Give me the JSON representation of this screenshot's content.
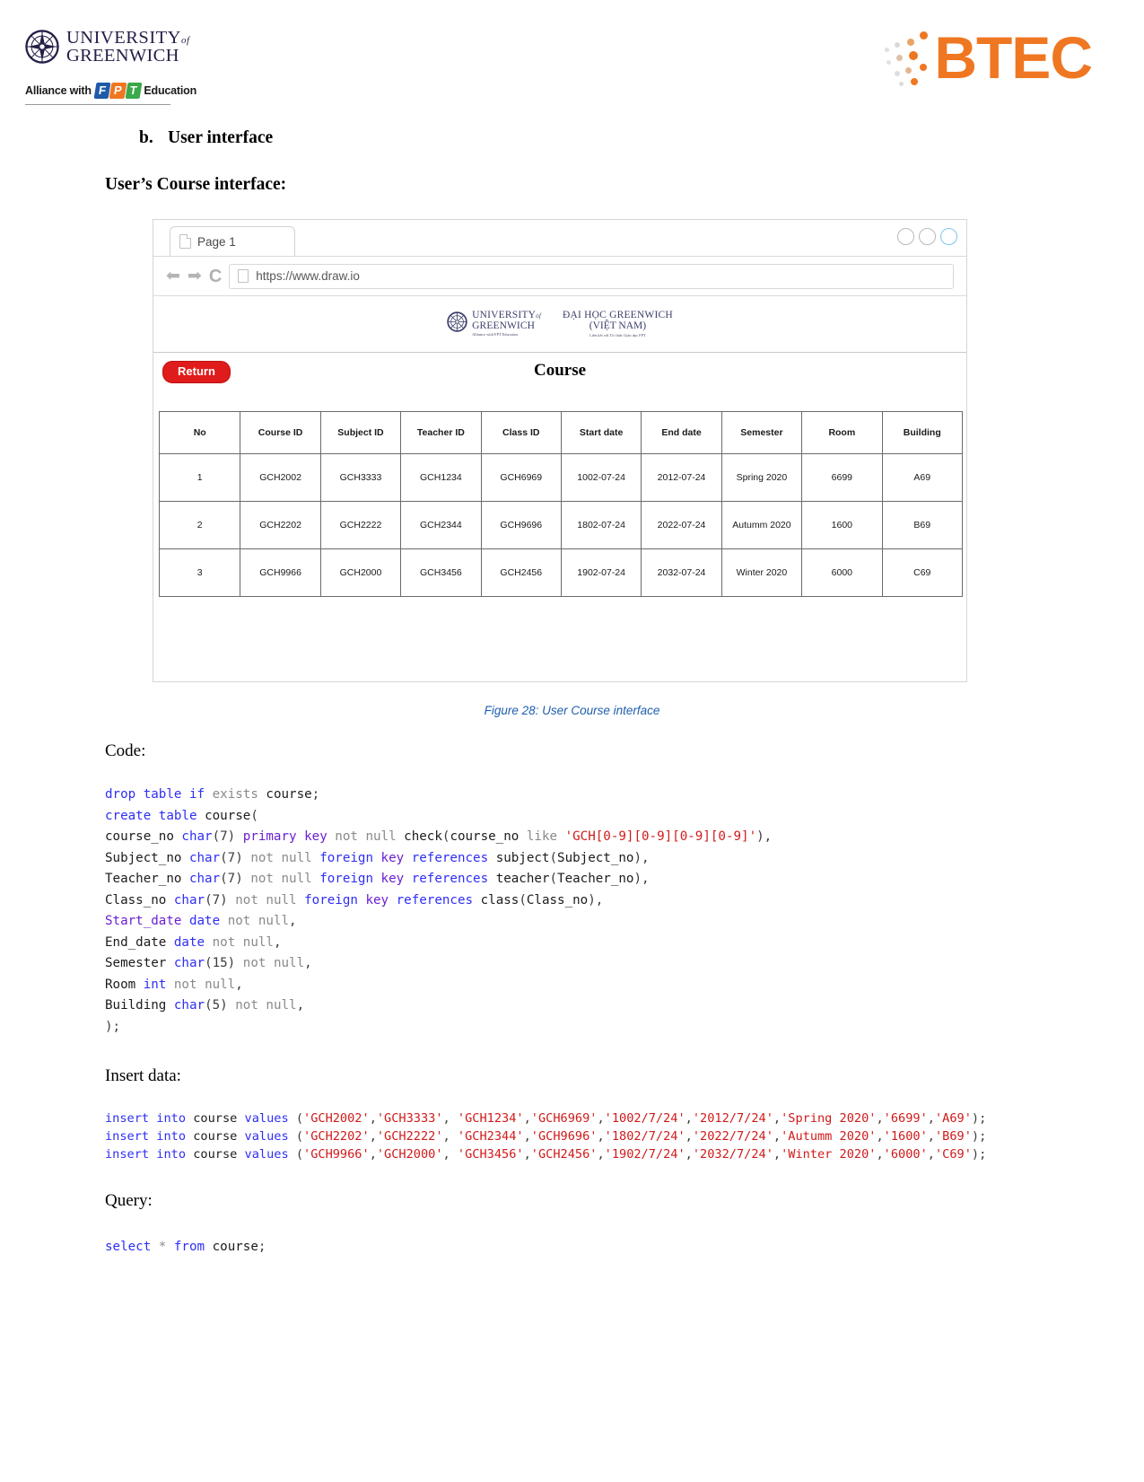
{
  "header": {
    "university_line1": "UNIVERSITY",
    "university_of": "of",
    "university_line2": "GREENWICH",
    "alliance_prefix": "Alliance with",
    "fpt_f": "F",
    "fpt_p": "P",
    "fpt_t": "T",
    "alliance_suffix": "Education",
    "btec_word": "BTEC"
  },
  "headings": {
    "section_marker": "b.",
    "section_title": "User interface",
    "subsection_title": "User’s Course interface:"
  },
  "browser": {
    "tab_label": "Page 1",
    "url": "https://www.draw.io",
    "inner_header": {
      "uog_line1": "UNIVERSITY",
      "uog_of": "of",
      "uog_line2": "GREENWICH",
      "uog_alliance": "Alliance with FPT Education",
      "vn_line1": "ĐẠI HỌC GREENWICH",
      "vn_line2": "(VIỆT NAM)",
      "vn_sub": "Liên kết với Tổ chức Giáo dục FPT"
    },
    "return_button": "Return",
    "page_title": "Course",
    "table": {
      "columns": [
        "No",
        "Course ID",
        "Subject ID",
        "Teacher ID",
        "Class ID",
        "Start date",
        "End date",
        "Semester",
        "Room",
        "Building"
      ],
      "rows": [
        [
          "1",
          "GCH2002",
          "GCH3333",
          "GCH1234",
          "GCH6969",
          "1002-07-24",
          "2012-07-24",
          "Spring 2020",
          "6699",
          "A69"
        ],
        [
          "2",
          "GCH2202",
          "GCH2222",
          "GCH2344",
          "GCH9696",
          "1802-07-24",
          "2022-07-24",
          "Autumm 2020",
          "1600",
          "B69"
        ],
        [
          "3",
          "GCH9966",
          "GCH2000",
          "GCH3456",
          "GCH2456",
          "1902-07-24",
          "2032-07-24",
          "Winter 2020",
          "6000",
          "C69"
        ]
      ]
    }
  },
  "figure_caption": "Figure 28: User Course interface",
  "sections": {
    "code_label": "Code:",
    "insert_label": "Insert data:",
    "query_label": "Query:"
  },
  "create_code_lines": [
    "drop table if exists course;",
    "create table course(",
    "course_no char(7) primary key not null check(course_no like 'GCH[0-9][0-9][0-9][0-9]'),",
    "Subject_no char(7) not null foreign key references subject(Subject_no),",
    "Teacher_no char(7) not null foreign key references teacher(Teacher_no),",
    "Class_no char(7) not null foreign key references class(Class_no),",
    "Start_date date not null,",
    "End_date date not null,",
    "Semester char(15) not null,",
    "Room int not null,",
    "Building char(5) not null,",
    ");"
  ],
  "insert_code_lines": [
    "insert into course values ('GCH2002','GCH3333', 'GCH1234','GCH6969','1002/7/24','2012/7/24','Spring 2020','6699','A69');",
    "insert into course values ('GCH2202','GCH2222', 'GCH2344','GCH9696','1802/7/24','2022/7/24','Autumm 2020','1600','B69');",
    "insert into course values ('GCH9966','GCH2000', 'GCH3456','GCH2456','1902/7/24','2032/7/24','Winter 2020','6000','C69');"
  ],
  "query_code_lines": [
    "select * from course;"
  ],
  "colors": {
    "accent_red": "#e01b1b",
    "btec_orange": "#ef7722",
    "caption_blue": "#1f5fae",
    "keyword_blue": "#2e2ef5",
    "string_red": "#d11a1a"
  }
}
